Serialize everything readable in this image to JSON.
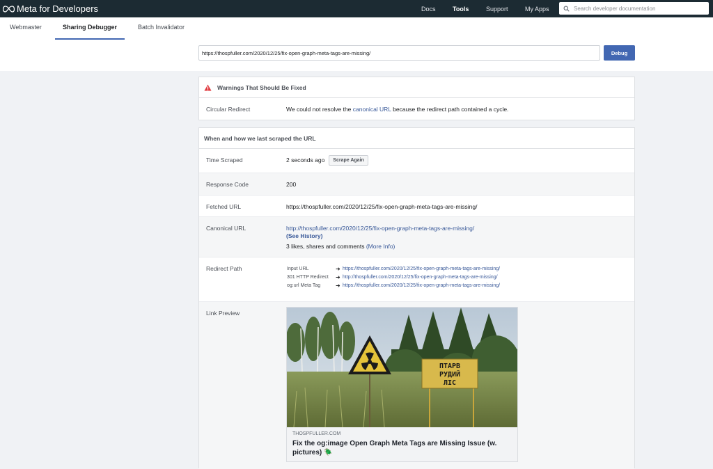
{
  "topbar": {
    "brand": "Meta for Developers",
    "nav": [
      {
        "label": "Docs"
      },
      {
        "label": "Tools",
        "active": true
      },
      {
        "label": "Support"
      },
      {
        "label": "My Apps"
      }
    ],
    "search_placeholder": "Search developer documentation"
  },
  "tabs": [
    {
      "label": "Webmaster"
    },
    {
      "label": "Sharing Debugger",
      "active": true
    },
    {
      "label": "Batch Invalidator"
    }
  ],
  "urlbar": {
    "value": "https://thospfuller.com/2020/12/25/fix-open-graph-meta-tags-are-missing/",
    "button": "Debug"
  },
  "warnings": {
    "title": "Warnings That Should Be Fixed",
    "label": "Circular Redirect",
    "text_before": "We could not resolve the ",
    "link": "canonical URL",
    "text_after": " because the redirect path contained a cycle."
  },
  "scrape": {
    "title": "When and how we last scraped the URL",
    "time_label": "Time Scraped",
    "time_value": "2 seconds ago",
    "scrape_button": "Scrape Again",
    "response_label": "Response Code",
    "response_value": "200",
    "fetched_label": "Fetched URL",
    "fetched_value": "https://thospfuller.com/2020/12/25/fix-open-graph-meta-tags-are-missing/",
    "canonical_label": "Canonical URL",
    "canonical_value": "http://thospfuller.com/2020/12/25/fix-open-graph-meta-tags-are-missing/",
    "see_history": "(See History)",
    "likes_text": "3 likes, shares and comments ",
    "more_info": "(More Info)",
    "redirect_label": "Redirect Path",
    "redirect_rows": [
      {
        "key": "Input URL",
        "url": "https://thospfuller.com/2020/12/25/fix-open-graph-meta-tags-are-missing/"
      },
      {
        "key": "301 HTTP Redirect",
        "url": "http://thospfuller.com/2020/12/25/fix-open-graph-meta-tags-are-missing/"
      },
      {
        "key": "og:url Meta Tag",
        "url": "https://thospfuller.com/2020/12/25/fix-open-graph-meta-tags-are-missing/"
      }
    ],
    "preview_label": "Link Preview",
    "preview_domain": "THOSPFULLER.COM",
    "preview_title": "Fix the og:image Open Graph Meta Tags are Missing Issue (w. pictures) 🪲",
    "preview_sign_lines": [
      "ПТАРВ",
      "РУДИЙ",
      "ЛІС"
    ]
  },
  "colors": {
    "topbar": "#1c2b33",
    "accent": "#4267b2",
    "link": "#385898",
    "warning": "#e0393e"
  }
}
